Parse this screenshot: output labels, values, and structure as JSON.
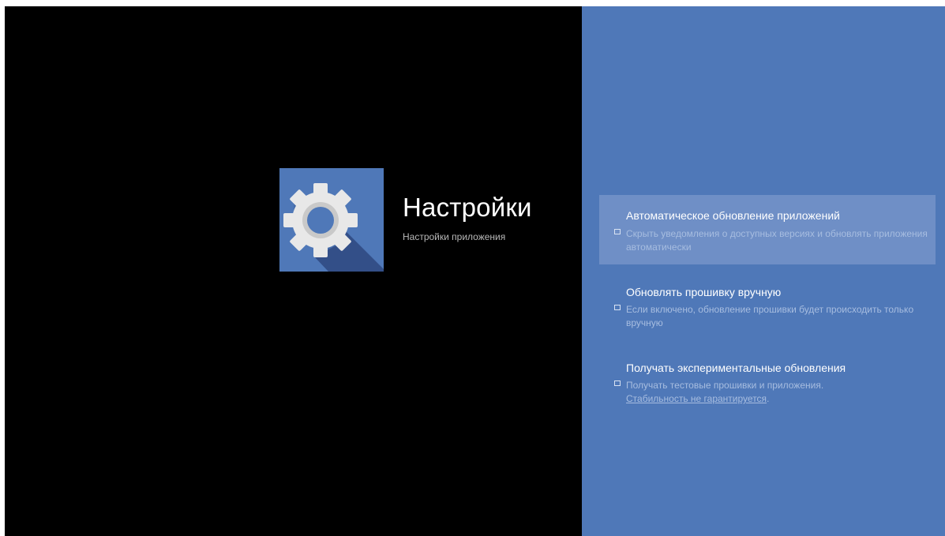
{
  "app": {
    "title": "Настройки",
    "subtitle": "Настройки приложения",
    "icon": "gear-icon"
  },
  "colors": {
    "background": "#000000",
    "panel": "#4f78b8",
    "selected_item": "#6f8fc6",
    "description_text": "#a7bde0"
  },
  "options": [
    {
      "title": "Автоматическое обновление приложений",
      "description": "Скрыть уведомления о доступных версиях и обновлять приложения автоматически",
      "checked": false,
      "selected": true
    },
    {
      "title": "Обновлять прошивку вручную",
      "description": "Если включено, обновление прошивки будет происходить только вручную",
      "checked": false,
      "selected": false
    },
    {
      "title": "Получать экспериментальные обновления",
      "description": "Получать тестовые прошивки и приложения.",
      "link_text": "Стабильность не гарантируется",
      "description_end": ".",
      "checked": false,
      "selected": false
    }
  ]
}
